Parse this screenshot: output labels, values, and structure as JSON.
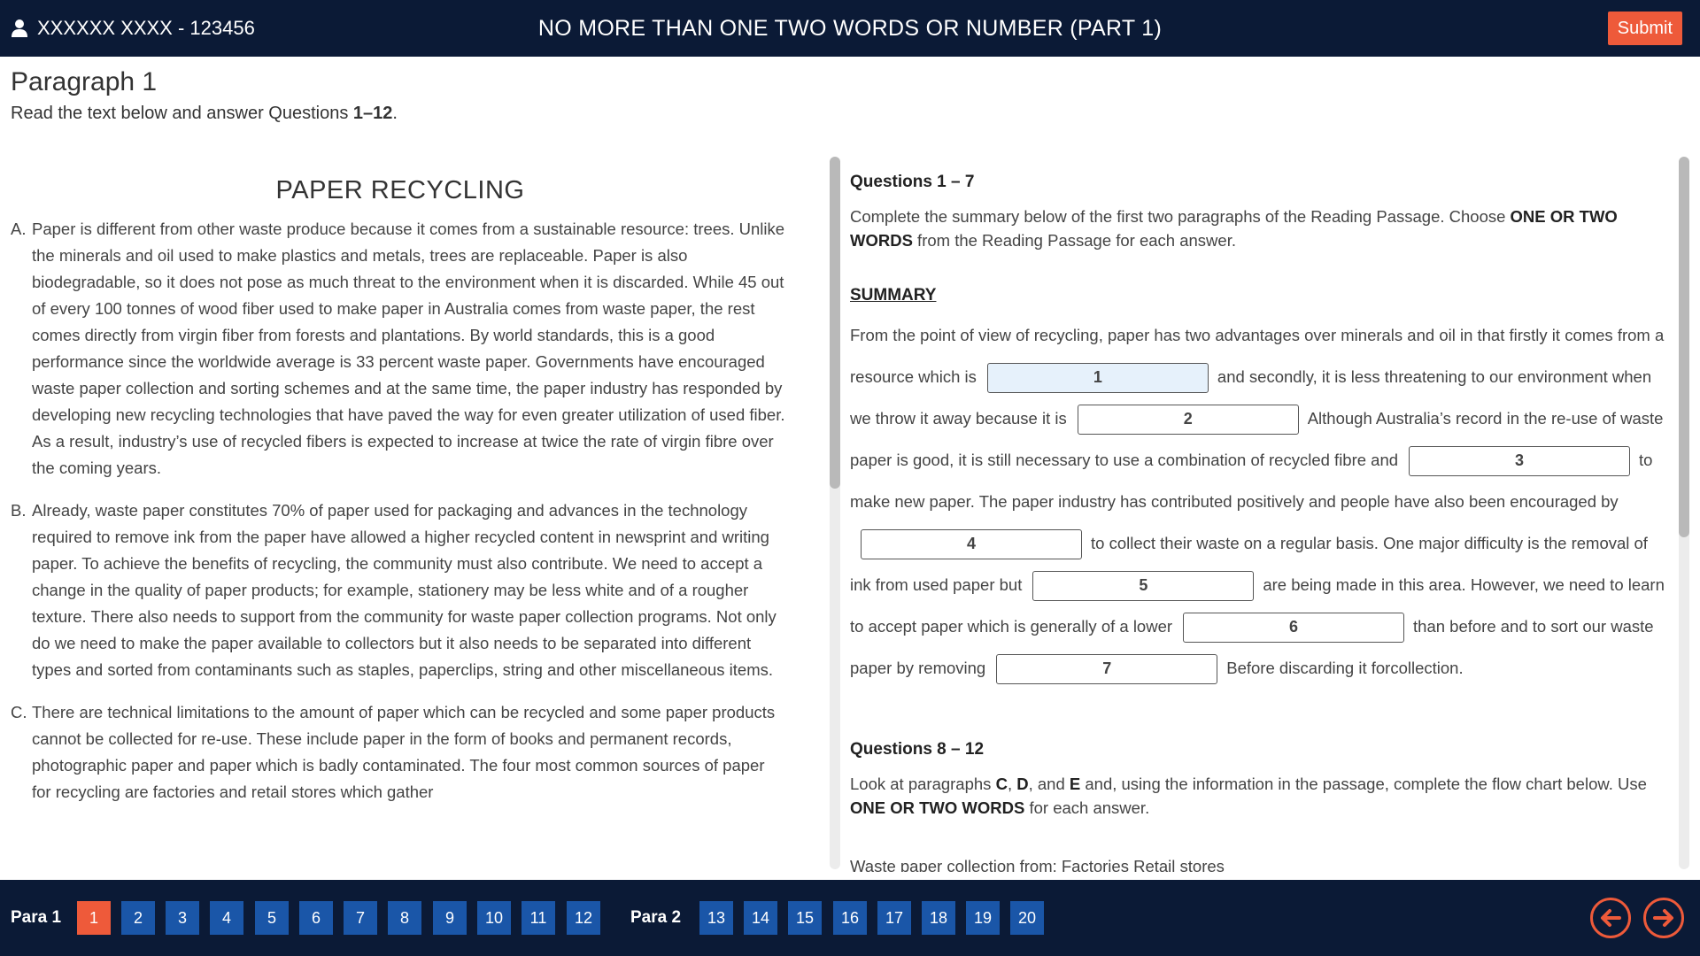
{
  "header": {
    "user": "XXXXXX XXXX - 123456",
    "title": "NO MORE THAN ONE TWO WORDS OR NUMBER (PART 1)",
    "submit_label": "Submit"
  },
  "intro": {
    "title": "Paragraph 1",
    "instructions_prefix": "Read the text below and answer Questions ",
    "instructions_range": "1–12",
    "instructions_suffix": "."
  },
  "passage": {
    "title": "PAPER RECYCLING",
    "paragraphs": [
      {
        "letter": "A.",
        "text": "Paper is different from other waste produce because it comes from a sustainable resource: trees. Unlike the minerals and oil used to make plastics and metals, trees are replaceable. Paper is also biodegradable, so it does not pose as much threat to the environment when it is discarded. While 45 out of every 100 tonnes of wood fiber used to make paper in Australia comes from waste paper, the rest comes directly from virgin fiber from forests and plantations. By world standards, this is a good performance since the worldwide average is 33 percent waste paper. Governments have encouraged waste paper collection and sorting schemes and at the same time, the paper industry has responded by developing new recycling technologies that have paved the way for even greater utilization of used fiber. As a result, industry’s use of recycled fibers is expected to increase at twice the rate of virgin fibre over the coming years."
      },
      {
        "letter": "B.",
        "text": "Already, waste paper constitutes 70% of paper used for packaging and advances in the technology required to remove ink from the paper have allowed a higher recycled content in newsprint and writing paper. To achieve the benefits of recycling, the community must also contribute. We need to accept a change in the quality of paper products; for example, stationery may be less white and of a rougher texture. There also needs to support from the community for waste paper collection programs. Not only do we need to make the paper available to collectors but it also needs to be separated into different types and sorted from contaminants such as staples, paperclips, string and other miscellaneous items."
      },
      {
        "letter": "C.",
        "text": "There are technical limitations to the amount of paper which can be recycled and some paper products cannot be collected for re-use. These include paper in the form of books and permanent records, photographic paper and paper which is badly contaminated. The four most common sources of paper for recycling are factories and retail stores which gather"
      }
    ]
  },
  "questions": {
    "q1_heading": "Questions 1 – 7",
    "q1_text_a": "Complete the summary below of the first two paragraphs of the Reading Passage. Choose ",
    "q1_text_b": "ONE OR TWO WORDS",
    "q1_text_c": " from the Reading Passage for each answer.",
    "summary_heading": "SUMMARY",
    "summary": {
      "s0": "From the point of view of recycling, paper has two advantages over minerals and oil in that firstly it comes from a resource which is",
      "s1": "and secondly, it is less threatening to our environment when we throw it away because it is",
      "s2": "Although Australia’s record in the re-use of waste paper is good, it is still necessary to use a combination of recycled fibre and",
      "s3": "to make new paper. The paper industry has contributed positively and people have also been encouraged by",
      "s4": "to collect their waste on a regular basis. One major difficulty is the removal of ink from used paper but",
      "s5": "are being made in this area. However, we need to learn to accept paper which is generally of a lower",
      "s6": "than before and to sort our waste paper by removing",
      "s7": "Before discarding it forcollection.",
      "gaps": [
        "1",
        "2",
        "3",
        "4",
        "5",
        "6",
        "7"
      ]
    },
    "q2_heading": "Questions 8 – 12",
    "q2_text": {
      "a": "Look at paragraphs ",
      "c": "C",
      "sep1": ", ",
      "d": "D",
      "sep2": ", and ",
      "e": "E",
      "b": " and, using the information in the passage, complete the flow chart below. Use ",
      "bold": "ONE OR TWO WORDS",
      "end": " for each answer."
    },
    "flow_text": "Waste paper collection from: Factories Retail stores"
  },
  "footer": {
    "para1_label": "Para 1",
    "para2_label": "Para 2",
    "para1_questions": [
      "1",
      "2",
      "3",
      "4",
      "5",
      "6",
      "7",
      "8",
      "9",
      "10",
      "11",
      "12"
    ],
    "para2_questions": [
      "13",
      "14",
      "15",
      "16",
      "17",
      "18",
      "19",
      "20"
    ],
    "current_question": "1"
  },
  "colors": {
    "header_bg": "#0b1a36",
    "accent": "#ee5a3a",
    "question_button": "#1a56a8",
    "active_gap": "#e6f1fb"
  },
  "icons": [
    "user-icon",
    "arrow-left-icon",
    "arrow-right-icon"
  ]
}
